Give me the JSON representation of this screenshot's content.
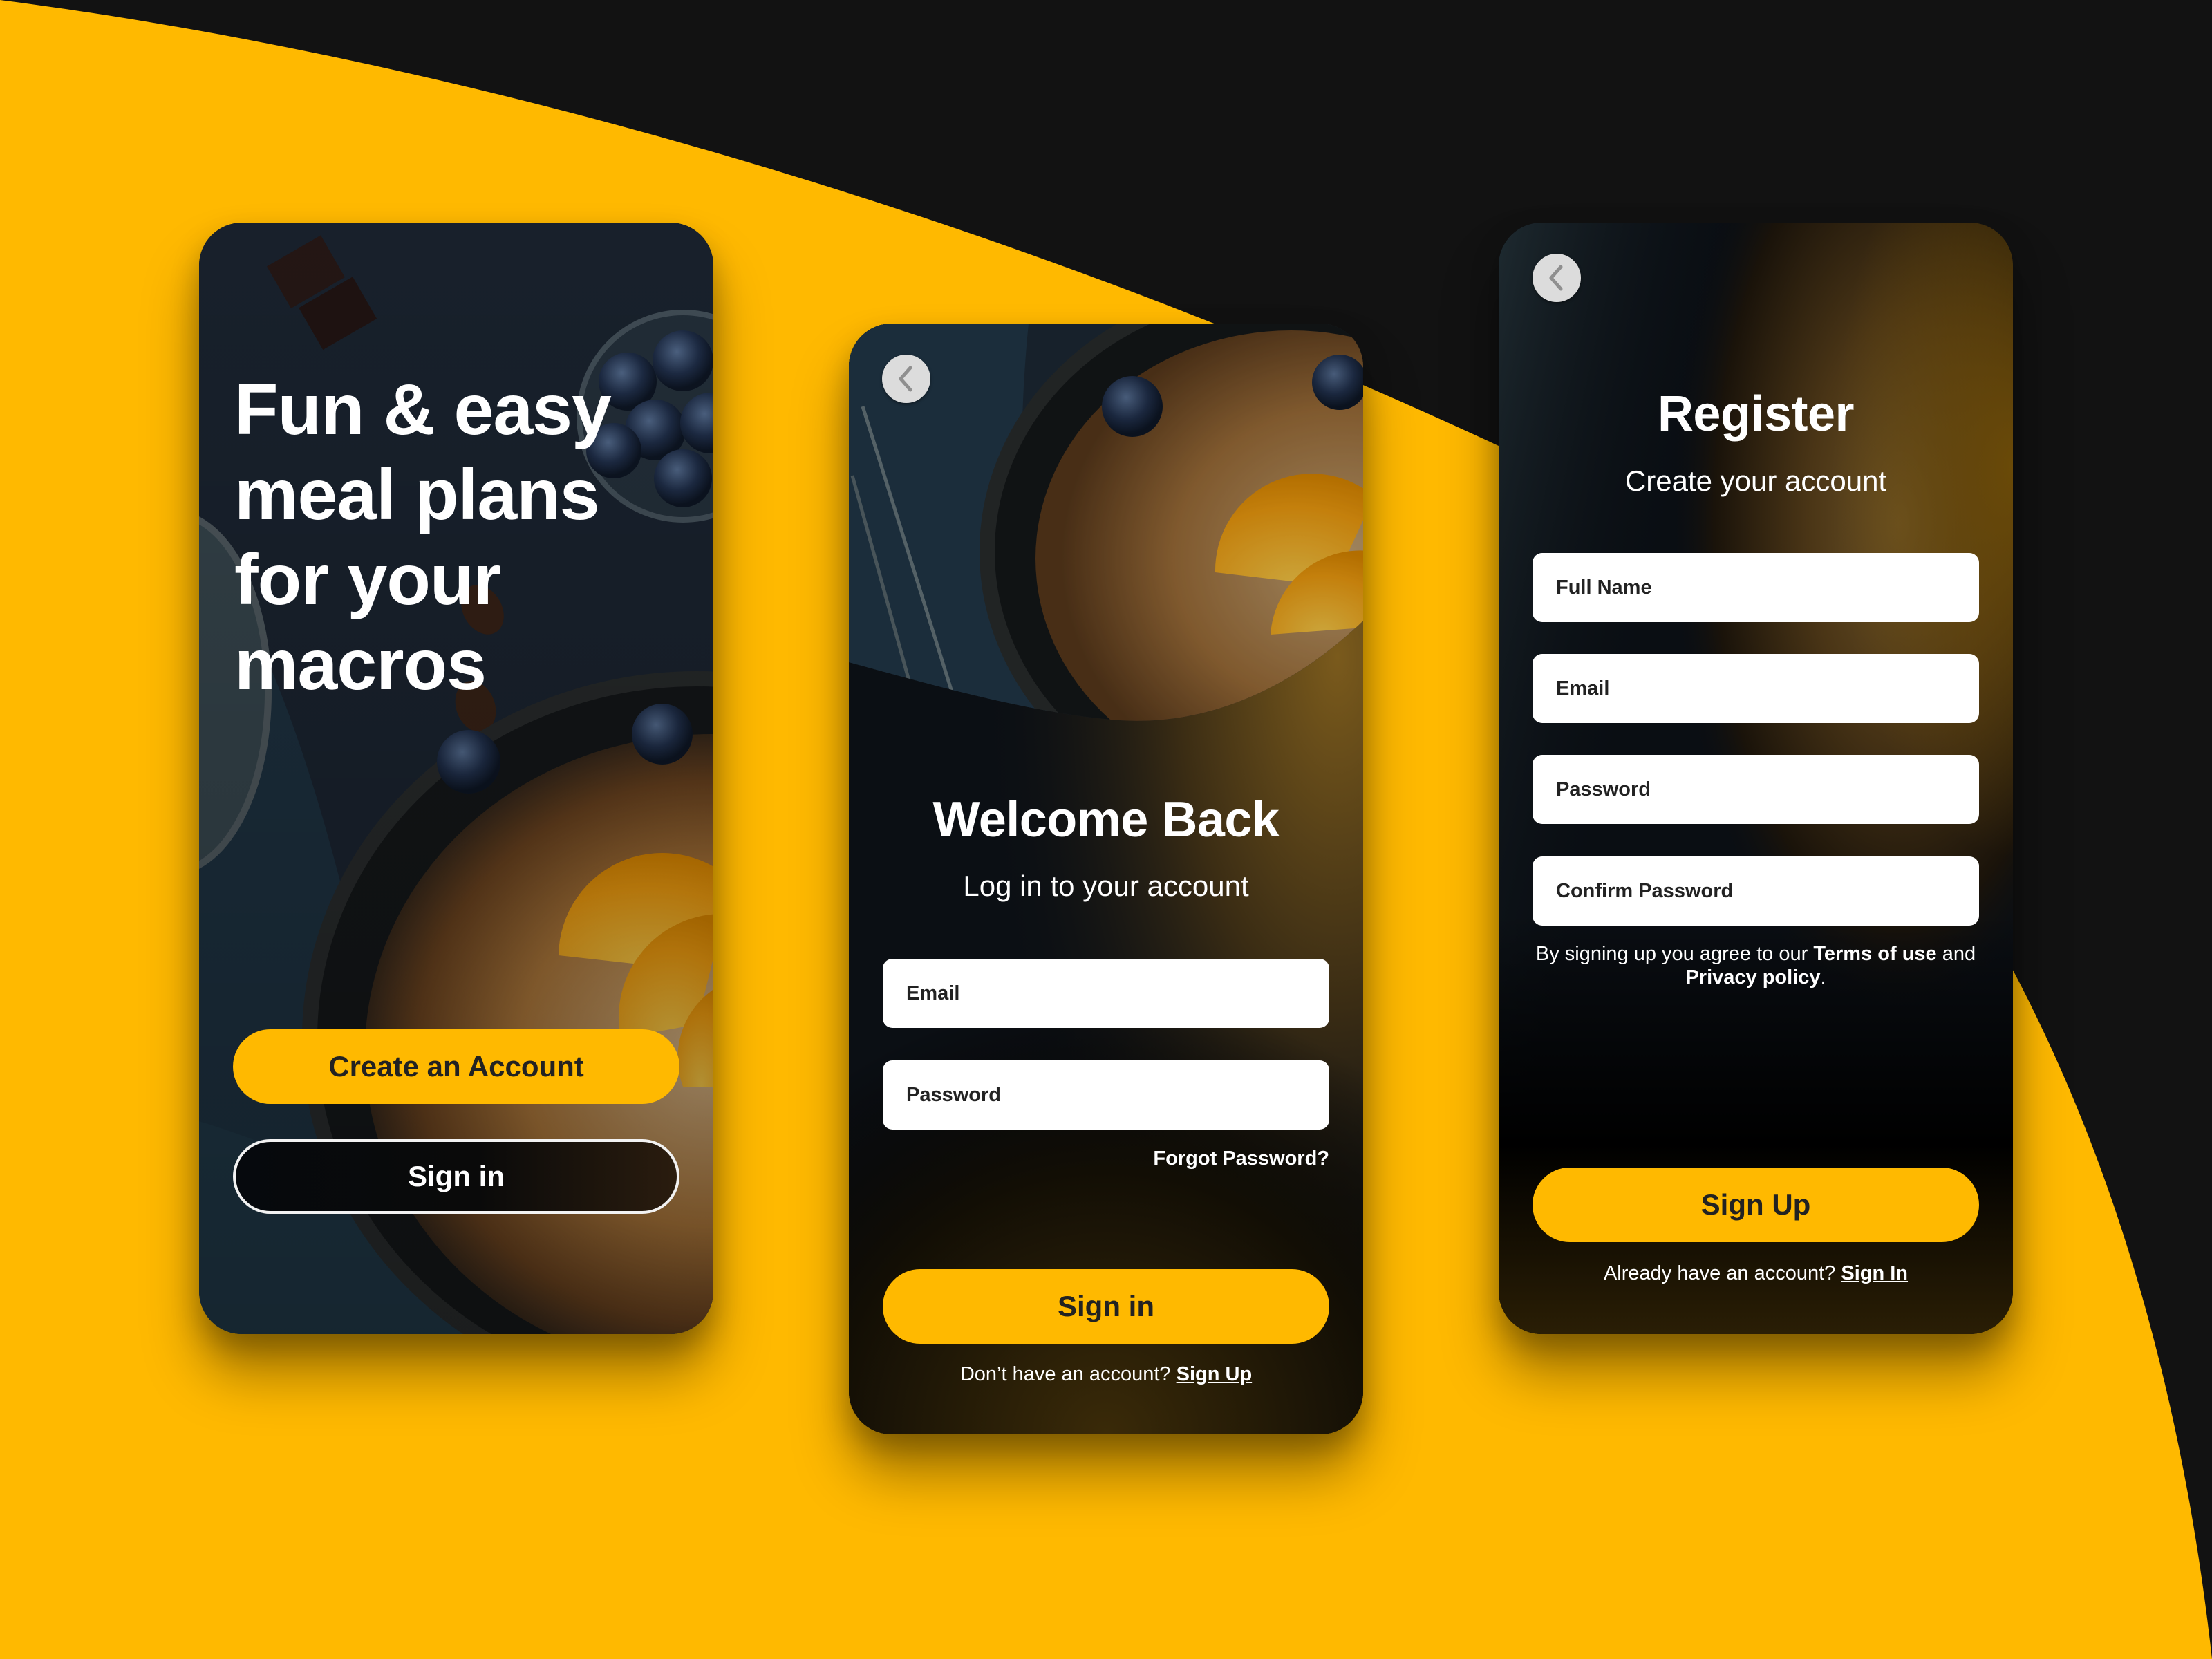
{
  "colors": {
    "accent": "#ffb900",
    "background_dark": "#121212",
    "button_text": "#222222",
    "field_bg": "#ffffff",
    "back_button": "#dcdcdc"
  },
  "welcome_screen": {
    "headline": "Fun & easy meal plans for your macros",
    "create_account_label": "Create an Account",
    "sign_in_label": "Sign in"
  },
  "login_screen": {
    "back_icon": "chevron-left-icon",
    "title": "Welcome Back",
    "subtitle": "Log in to your account",
    "fields": [
      {
        "placeholder": "Email",
        "value": ""
      },
      {
        "placeholder": "Password",
        "value": ""
      }
    ],
    "forgot_password": "Forgot Password?",
    "sign_in_label": "Sign in",
    "footer_text": "Don’t have an account? ",
    "footer_link": "Sign Up"
  },
  "register_screen": {
    "back_icon": "chevron-left-icon",
    "title": "Register",
    "subtitle": "Create your account",
    "fields": [
      {
        "placeholder": "Full Name",
        "value": ""
      },
      {
        "placeholder": "Email",
        "value": ""
      },
      {
        "placeholder": "Password",
        "value": ""
      },
      {
        "placeholder": "Confirm Password",
        "value": ""
      }
    ],
    "terms_prefix": "By signing up you agree to our ",
    "terms_link": "Terms of use",
    "terms_middle": " and",
    "privacy_link": "Privacy policy",
    "terms_suffix": ".",
    "sign_up_label": "Sign Up",
    "footer_text": "Already have an account? ",
    "footer_link": "Sign In"
  }
}
